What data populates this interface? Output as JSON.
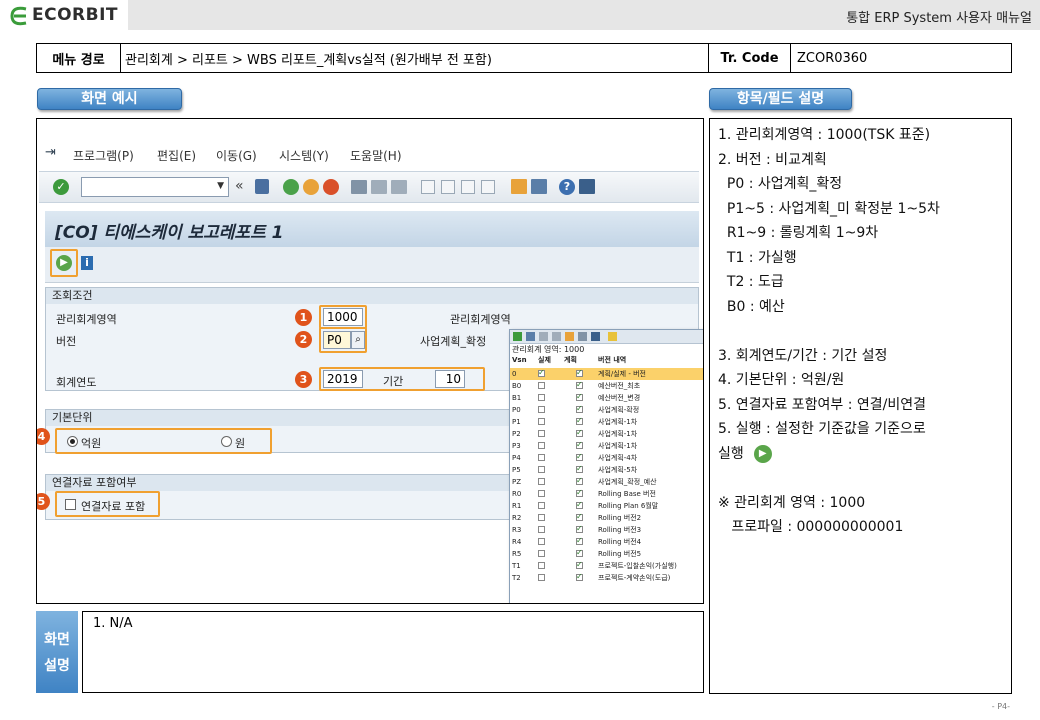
{
  "header": {
    "logo": "ECORBIT",
    "manual_title": "통합 ERP System 사용자 매뉴얼"
  },
  "menu_path": {
    "label": "메뉴 경로",
    "value": "관리회계 > 리포트 > WBS 리포트_계획vs실적 (원가배부 전 포함)",
    "tr_label": "Tr. Code",
    "tr_value": "ZCOR0360"
  },
  "sections": {
    "screen_example": "화면 예시",
    "field_desc": "항목/필드 설명"
  },
  "sap": {
    "menu": [
      "프로그램(P)",
      "편집(E)",
      "이동(G)",
      "시스템(Y)",
      "도움말(H)"
    ],
    "title": "[CO] 티에스케이 보고레포트 1",
    "group1": "조회조건",
    "f_area_label": "관리회계영역",
    "f_area_value": "1000",
    "f_area_desc": "관리회계영역",
    "f_version_label": "버전",
    "f_version_value": "P0",
    "f_version_desc": "사업계획_확정",
    "f_year_label": "회계연도",
    "f_year_value": "2019",
    "f_period_label": "기간",
    "f_period_value": "10",
    "group2": "기본단위",
    "radio1": "억원",
    "radio2": "원",
    "group3": "연결자료 포함여부",
    "check_label": "연결자료 포함"
  },
  "badges": [
    "1",
    "2",
    "3",
    "4",
    "5"
  ],
  "popup": {
    "subtitle": "관리회계 영역: 1000",
    "headers": [
      "Vsn",
      "실제",
      "계획",
      "버전 내역"
    ],
    "rows": [
      {
        "vsn": "0",
        "actual": true,
        "plan": true,
        "desc": "계획/실제 - 버전",
        "selected": true
      },
      {
        "vsn": "B0",
        "actual": false,
        "plan": true,
        "desc": "예산버전_최초"
      },
      {
        "vsn": "B1",
        "actual": false,
        "plan": true,
        "desc": "예산버전_변경"
      },
      {
        "vsn": "P0",
        "actual": false,
        "plan": true,
        "desc": "사업계획-확정"
      },
      {
        "vsn": "P1",
        "actual": false,
        "plan": true,
        "desc": "사업계획-1차"
      },
      {
        "vsn": "P2",
        "actual": false,
        "plan": true,
        "desc": "사업계획-1차"
      },
      {
        "vsn": "P3",
        "actual": false,
        "plan": true,
        "desc": "사업계획-1차"
      },
      {
        "vsn": "P4",
        "actual": false,
        "plan": true,
        "desc": "사업계획-4차"
      },
      {
        "vsn": "P5",
        "actual": false,
        "plan": true,
        "desc": "사업계획-5차"
      },
      {
        "vsn": "PZ",
        "actual": false,
        "plan": true,
        "desc": "사업계획_확정_예산"
      },
      {
        "vsn": "R0",
        "actual": false,
        "plan": true,
        "desc": "Rolling Base 버전"
      },
      {
        "vsn": "R1",
        "actual": false,
        "plan": true,
        "desc": "Rolling Plan 6월말"
      },
      {
        "vsn": "R2",
        "actual": false,
        "plan": true,
        "desc": "Rolling 버전2"
      },
      {
        "vsn": "R3",
        "actual": false,
        "plan": true,
        "desc": "Rolling 버전3"
      },
      {
        "vsn": "R4",
        "actual": false,
        "plan": true,
        "desc": "Rolling 버전4"
      },
      {
        "vsn": "R5",
        "actual": false,
        "plan": true,
        "desc": "Rolling 버전5"
      },
      {
        "vsn": "T1",
        "actual": false,
        "plan": true,
        "desc": "프로젝트-입찰손익(가실행)"
      },
      {
        "vsn": "T2",
        "actual": false,
        "plan": true,
        "desc": "프로젝트-계약손익(도급)"
      }
    ]
  },
  "desc_lines": [
    "1. 관리회계영역 : 1000(TSK 표준)",
    "2. 버전 : 비교계획",
    "  P0 : 사업계획_확정",
    "  P1~5 : 사업계획_미 확정분 1~5차",
    "  R1~9 : 롤링계획 1~9차",
    "  T1 : 가실행",
    "  T2 : 도급",
    "  B0 : 예산",
    "",
    "3. 회계연도/기간 : 기간 설정",
    "4. 기본단위 : 억원/원",
    "5. 연결자료 포함여부 : 연결/비연결",
    "5. 실행 : 설정한 기준값을 기준으로",
    "실행",
    "",
    "※ 관리회계 영역 : 1000",
    "   프로파일 : 000000000001"
  ],
  "explanation": {
    "side_label_1": "화면",
    "side_label_2": "설명",
    "text": "1.   N/A"
  },
  "page_number": "- P4-",
  "colors": {
    "accent_blue": "#3f83c4",
    "badge_orange": "#e0531b",
    "highlight_orange": "#f0a030"
  }
}
